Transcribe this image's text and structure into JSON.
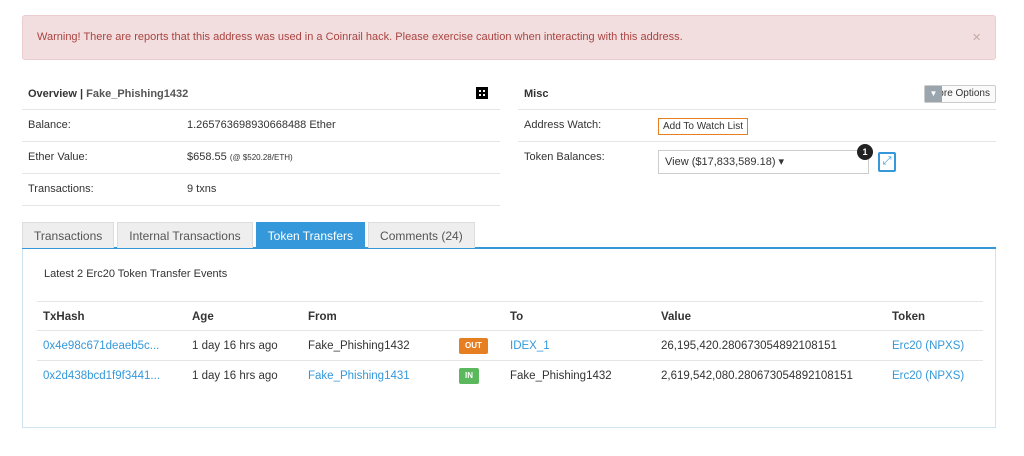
{
  "alert": {
    "message": "Warning! There are reports that this address was used in a Coinrail hack. Please exercise caution when interacting with this address.",
    "close": "×"
  },
  "overview": {
    "title": "Overview | ",
    "name": "Fake_Phishing1432",
    "qr_icon": "qr-code-icon",
    "rows": [
      {
        "label": "Balance:",
        "value": "1.265763698930668488 Ether",
        "extra": ""
      },
      {
        "label": "Ether Value:",
        "value": "$658.55",
        "extra": "(@ $520.28/ETH)"
      },
      {
        "label": "Transactions:",
        "value": "9 txns",
        "extra": ""
      }
    ]
  },
  "misc": {
    "title": "Misc",
    "more_options": "More Options",
    "watch_label": "Address Watch:",
    "watch_button": "Add To Watch List",
    "token_label": "Token Balances:",
    "token_value": "View ($17,833,589.18) ▾",
    "token_count": "1"
  },
  "tabs": [
    {
      "label": "Transactions",
      "active": false
    },
    {
      "label": "Internal Transactions",
      "active": false
    },
    {
      "label": "Token Transfers",
      "active": true
    },
    {
      "label": "Comments (24)",
      "active": false
    }
  ],
  "transfers": {
    "caption": "Latest 2 Erc20 Token Transfer Events",
    "columns": [
      "TxHash",
      "Age",
      "From",
      "To",
      "Value",
      "Token"
    ],
    "rows": [
      {
        "hash": "0x4e98c671deaeb5c...",
        "age": "1 day 16 hrs ago",
        "from": "Fake_Phishing1432",
        "direction": "OUT",
        "to": "IDEX_1",
        "value": "26,195,420.280673054892108151",
        "token": "Erc20 (NPXS)"
      },
      {
        "hash": "0x2d438bcd1f9f3441...",
        "age": "1 day 16 hrs ago",
        "from": "Fake_Phishing1431",
        "direction": "IN",
        "to": "Fake_Phishing1432",
        "value": "2,619,542,080.280673054892108151",
        "token": "Erc20 (NPXS)"
      }
    ]
  },
  "colors": {
    "accent": "#3498db",
    "warning_bg": "#f2dede",
    "warning_text": "#a94442",
    "out": "#e67e22",
    "in": "#5cb85c"
  }
}
